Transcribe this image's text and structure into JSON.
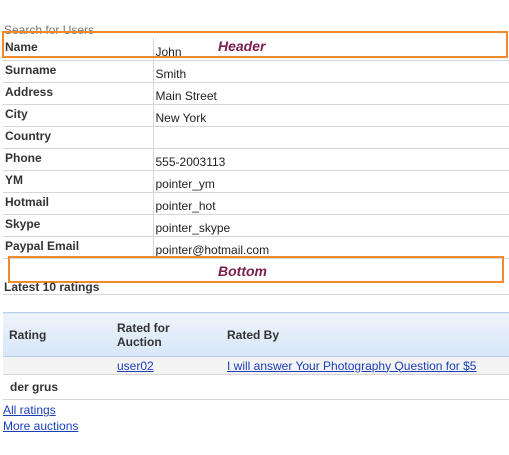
{
  "page": {
    "title": "Search for Users"
  },
  "profile": {
    "fields": [
      {
        "label": "Name",
        "value": "John"
      },
      {
        "label": "Surname",
        "value": "Smith"
      },
      {
        "label": "Address",
        "value": "Main Street"
      },
      {
        "label": "City",
        "value": "New York"
      },
      {
        "label": "Country",
        "value": ""
      },
      {
        "label": "Phone",
        "value": "555-2003113"
      },
      {
        "label": "YM",
        "value": "pointer_ym"
      },
      {
        "label": "Hotmail",
        "value": "pointer_hot"
      },
      {
        "label": "Skype",
        "value": "pointer_skype"
      },
      {
        "label": "Paypal Email",
        "value": "pointer@hotmail.com"
      }
    ]
  },
  "annotations": {
    "header": "Header",
    "bottom": "Bottom",
    "color": "#f08a2a",
    "text_color": "#7a1f4f"
  },
  "ratings": {
    "title": "Latest 10 ratings",
    "headers": {
      "rating": "Rating",
      "rated_for": "Rated for Auction",
      "rated_by": "Rated By"
    },
    "rows": [
      {
        "rating": "",
        "rated_by_user": "user02",
        "auction": "I will answer Your Photography Question for $5"
      }
    ]
  },
  "user_display": "der grus",
  "links": {
    "all_ratings": "All ratings",
    "more_auctions": "More auctions"
  }
}
